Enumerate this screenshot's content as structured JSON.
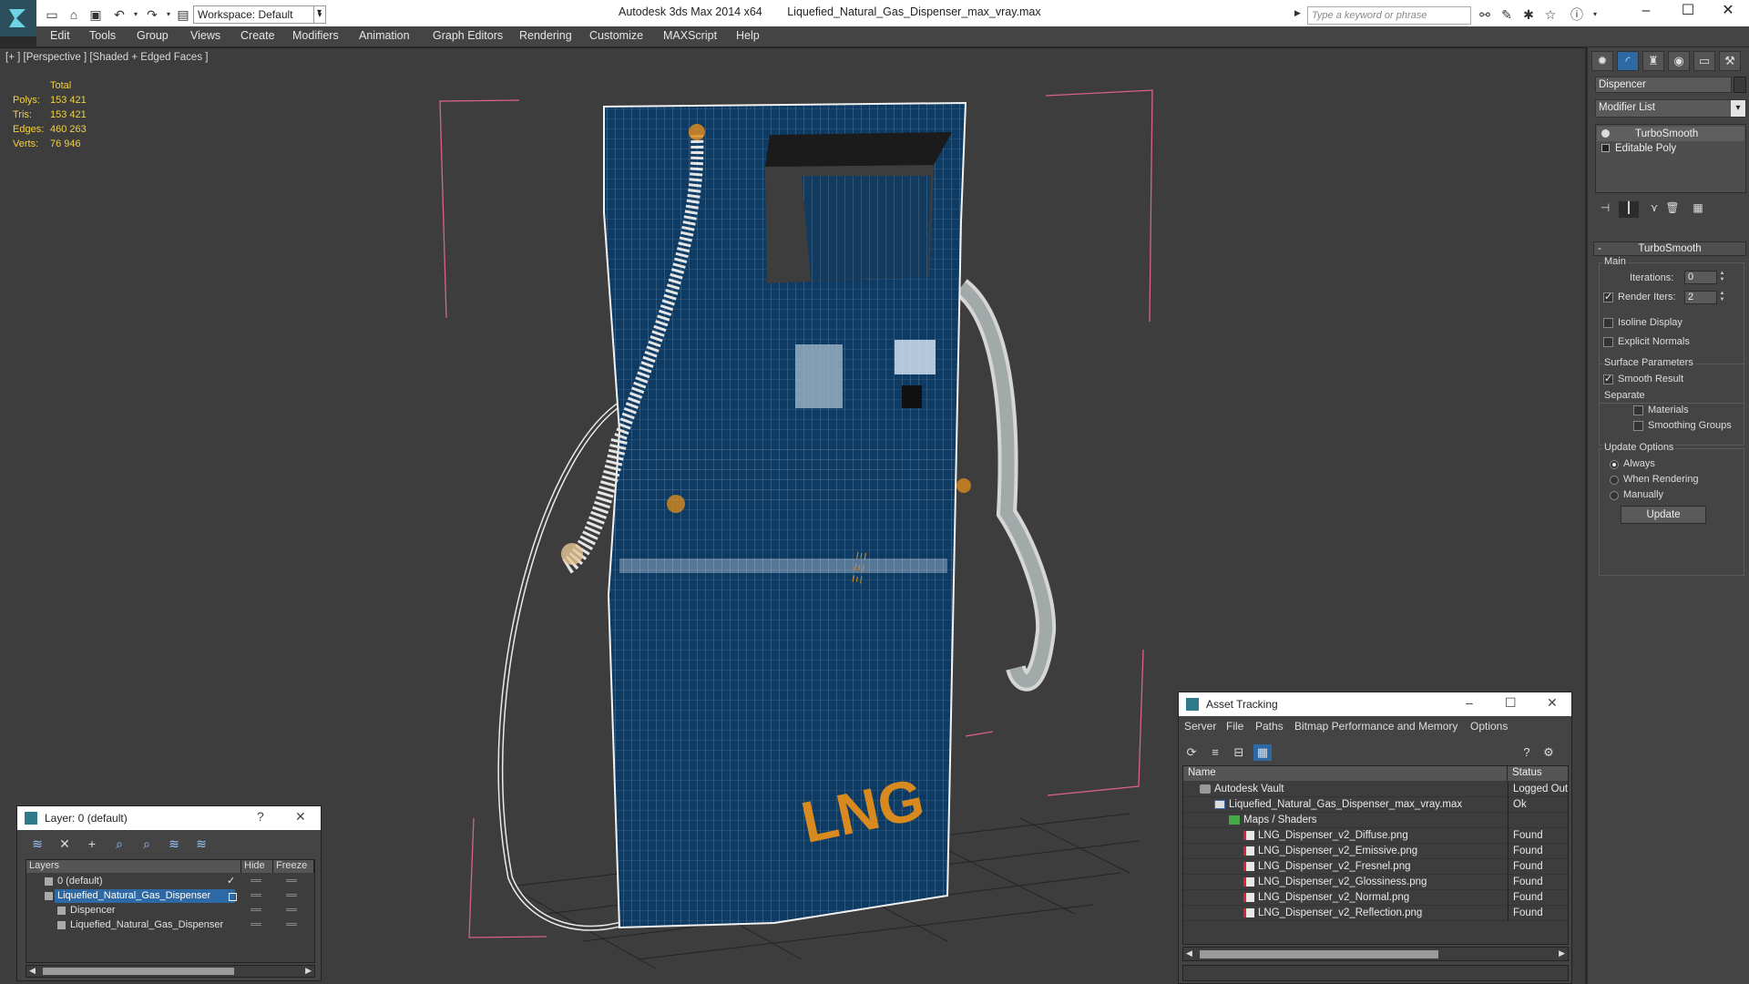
{
  "titlebar": {
    "workspace": "Workspace: Default",
    "app_title": "Autodesk 3ds Max  2014 x64",
    "file_title": "Liquefied_Natural_Gas_Dispenser_max_vray.max",
    "search_placeholder": "Type a keyword or phrase"
  },
  "menu": [
    "Edit",
    "Tools",
    "Group",
    "Views",
    "Create",
    "Modifiers",
    "Animation",
    "Graph Editors",
    "Rendering",
    "Customize",
    "MAXScript",
    "Help"
  ],
  "viewport": {
    "label": "[+ ] [Perspective ] [Shaded + Edged Faces ]",
    "stats": {
      "header": "Total",
      "rows": [
        {
          "label": "Polys:",
          "value": "153 421"
        },
        {
          "label": "Tris:",
          "value": "153 421"
        },
        {
          "label": "Edges:",
          "value": "460 263"
        },
        {
          "label": "Verts:",
          "value": "76 946"
        }
      ]
    },
    "model_text": "LNG",
    "colors": {
      "wire": "#ffffff",
      "body": "#0d3a60",
      "accent": "#d98a1e",
      "bbox": "#d9628a"
    }
  },
  "command_panel": {
    "object_name": "Dispencer",
    "modifier_list": "Modifier List",
    "stack": [
      "TurboSmooth",
      "Editable Poly"
    ],
    "rollout_title": "TurboSmooth",
    "main_group": "Main",
    "iterations_label": "Iterations:",
    "iterations_value": "0",
    "render_iters_label": "Render Iters:",
    "render_iters_value": "2",
    "render_iters_checked": true,
    "isoline_label": "Isoline Display",
    "explicit_normals_label": "Explicit Normals",
    "surface_group": "Surface Parameters",
    "smooth_result_label": "Smooth Result",
    "smooth_result_checked": true,
    "separate_label": "Separate",
    "materials_label": "Materials",
    "smoothing_groups_label": "Smoothing Groups",
    "update_group": "Update Options",
    "update_options": [
      "Always",
      "When Rendering",
      "Manually"
    ],
    "update_selected": "Always",
    "update_button": "Update"
  },
  "layer_window": {
    "title": "Layer: 0 (default)",
    "help": "?",
    "columns": [
      "Layers",
      "Hide",
      "Freeze"
    ],
    "rows": [
      {
        "name": "0 (default)",
        "current": true
      },
      {
        "name": "Liquefied_Natural_Gas_Dispenser",
        "selected": true
      },
      {
        "name": "Dispencer"
      },
      {
        "name": "Liquefied_Natural_Gas_Dispenser"
      }
    ]
  },
  "asset_window": {
    "title": "Asset Tracking",
    "menu": [
      "Server",
      "File",
      "Paths",
      "Bitmap Performance and Memory",
      "Options"
    ],
    "columns": [
      "Name",
      "Status"
    ],
    "rows": [
      {
        "name": "Autodesk Vault",
        "status": "Logged Out",
        "icon": "vault",
        "indent": 0
      },
      {
        "name": "Liquefied_Natural_Gas_Dispenser_max_vray.max",
        "status": "Ok",
        "icon": "max",
        "indent": 1
      },
      {
        "name": "Maps / Shaders",
        "status": "",
        "icon": "maps",
        "indent": 2
      },
      {
        "name": "LNG_Dispenser_v2_Diffuse.png",
        "status": "Found",
        "icon": "png",
        "indent": 3
      },
      {
        "name": "LNG_Dispenser_v2_Emissive.png",
        "status": "Found",
        "icon": "png",
        "indent": 3
      },
      {
        "name": "LNG_Dispenser_v2_Fresnel.png",
        "status": "Found",
        "icon": "png",
        "indent": 3
      },
      {
        "name": "LNG_Dispenser_v2_Glossiness.png",
        "status": "Found",
        "icon": "png",
        "indent": 3
      },
      {
        "name": "LNG_Dispenser_v2_Normal.png",
        "status": "Found",
        "icon": "png",
        "indent": 3
      },
      {
        "name": "LNG_Dispenser_v2_Reflection.png",
        "status": "Found",
        "icon": "png",
        "indent": 3
      }
    ]
  }
}
